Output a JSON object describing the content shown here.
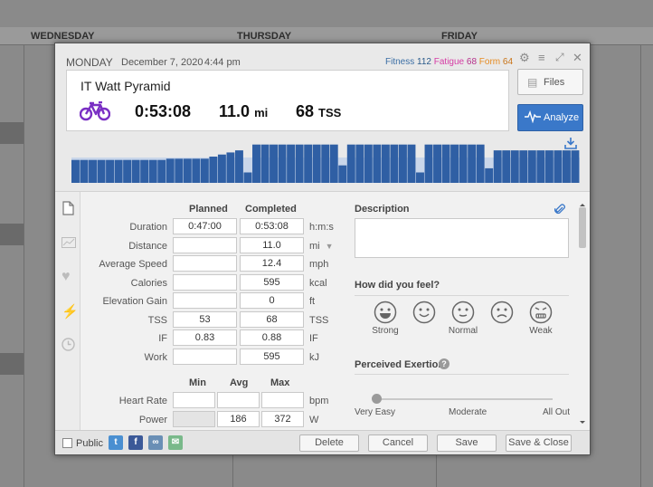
{
  "calendar": {
    "days": [
      "WEDNESDAY",
      "THURSDAY",
      "FRIDAY"
    ]
  },
  "header": {
    "day": "MONDAY",
    "date": "December 7, 2020",
    "time": "4:44 pm",
    "fitness_label": "Fitness",
    "fitness_value": "112",
    "fatigue_label": "Fatigue",
    "fatigue_value": "68",
    "form_label": "Form",
    "form_value": "64"
  },
  "workout": {
    "title": "IT Watt Pyramid",
    "duration": "0:53:08",
    "distance": "11.0",
    "distance_unit": "mi",
    "tss": "68",
    "tss_unit": "TSS"
  },
  "buttons": {
    "files": "Files",
    "analyze": "Analyze",
    "delete": "Delete",
    "cancel": "Cancel",
    "save": "Save",
    "save_close": "Save & Close"
  },
  "structure_chart": {
    "levels": [
      0.55,
      0.55,
      0.55,
      0.55,
      0.55,
      0.55,
      0.55,
      0.55,
      0.55,
      0.55,
      0.55,
      0.58,
      0.58,
      0.58,
      0.58,
      0.58,
      0.63,
      0.68,
      0.73,
      0.78,
      0.25,
      0.92,
      0.92,
      0.92,
      0.92,
      0.92,
      0.92,
      0.92,
      0.92,
      0.92,
      0.92,
      0.42,
      0.92,
      0.92,
      0.92,
      0.92,
      0.92,
      0.92,
      0.92,
      0.92,
      0.25,
      0.92,
      0.92,
      0.92,
      0.92,
      0.92,
      0.92,
      0.92,
      0.35,
      0.78,
      0.78,
      0.78,
      0.78,
      0.78,
      0.78,
      0.78,
      0.78,
      0.78,
      0.78
    ],
    "color": "#2f5fa4"
  },
  "form": {
    "planned_header": "Planned",
    "completed_header": "Completed",
    "rows": [
      {
        "label": "Duration",
        "planned": "0:47:00",
        "completed": "0:53:08",
        "unit": "h:m:s"
      },
      {
        "label": "Distance",
        "planned": "",
        "completed": "11.0",
        "unit": "mi"
      },
      {
        "label": "Average Speed",
        "planned": "",
        "completed": "12.4",
        "unit": "mph"
      },
      {
        "label": "Calories",
        "planned": "",
        "completed": "595",
        "unit": "kcal"
      },
      {
        "label": "Elevation Gain",
        "planned": "",
        "completed": "0",
        "unit": "ft"
      },
      {
        "label": "TSS",
        "planned": "53",
        "completed": "68",
        "unit": "TSS"
      },
      {
        "label": "IF",
        "planned": "0.83",
        "completed": "0.88",
        "unit": "IF"
      },
      {
        "label": "Work",
        "planned": "",
        "completed": "595",
        "unit": "kJ"
      }
    ],
    "min_header": "Min",
    "avg_header": "Avg",
    "max_header": "Max",
    "hr_rows": [
      {
        "label": "Heart Rate",
        "min": "",
        "avg": "",
        "max": "",
        "unit": "bpm"
      },
      {
        "label": "Power",
        "min": "",
        "avg": "186",
        "max": "372",
        "unit": "W"
      }
    ]
  },
  "description": {
    "header": "Description",
    "value": ""
  },
  "feel": {
    "header": "How did you feel?",
    "labels": [
      "Strong",
      "Normal",
      "Weak"
    ]
  },
  "exertion": {
    "header": "Perceived Exertion",
    "help": "?",
    "labels": [
      "Very Easy",
      "Moderate",
      "All Out"
    ]
  },
  "footer": {
    "public_label": "Public"
  },
  "icons": {
    "settings": "gear-icon",
    "menu": "menu-icon",
    "expand": "expand-icon",
    "close": "close-icon",
    "bike": "bike-icon",
    "download": "download-icon",
    "attachment": "paperclip-icon"
  },
  "colors": {
    "accent": "#3a78c9",
    "bike": "#7a2fc4",
    "fitness": "#3a6ea5",
    "fatigue": "#d63ca5",
    "form": "#e68a1f"
  }
}
